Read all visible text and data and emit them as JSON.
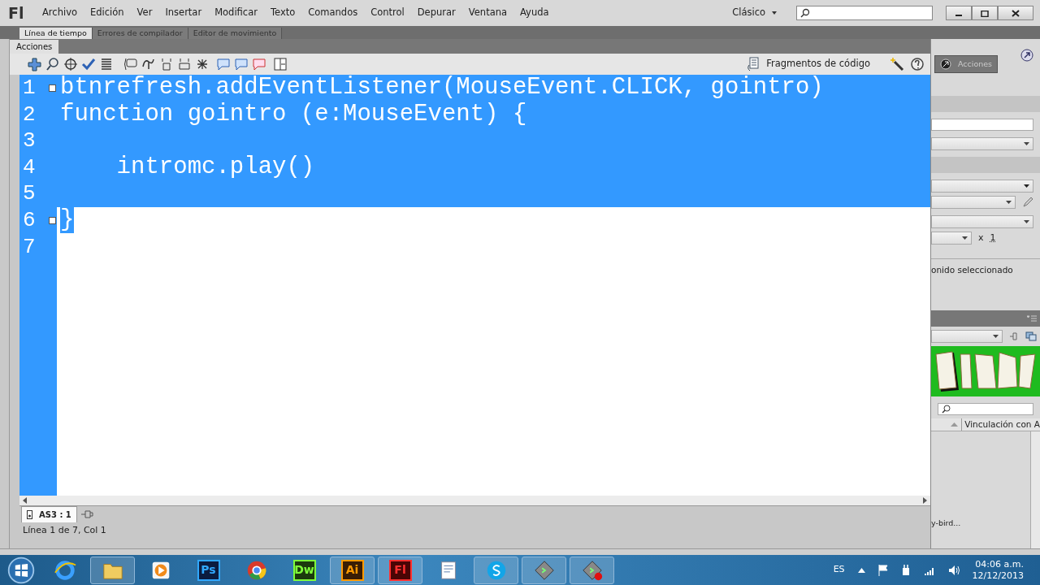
{
  "app_logo": "Fl",
  "menu": [
    "Archivo",
    "Edición",
    "Ver",
    "Insertar",
    "Modificar",
    "Texto",
    "Comandos",
    "Control",
    "Depurar",
    "Ventana",
    "Ayuda"
  ],
  "workspace": "Clásico",
  "panel_tabs": [
    {
      "label": "Línea de tiempo",
      "selected": true
    },
    {
      "label": "Errores de compilador",
      "selected": false
    },
    {
      "label": "Editor de movimiento",
      "selected": false
    }
  ],
  "actions_panel": {
    "title": "Acciones",
    "snippets_label": "Fragmentos de código",
    "lines": [
      {
        "number": "1",
        "text": "btnrefresh.addEventListener(MouseEvent.CLICK, gointro)",
        "selected": true,
        "whole_line": true,
        "fold": true
      },
      {
        "number": "2",
        "text": "function gointro (e:MouseEvent) {",
        "selected": true,
        "whole_line": true,
        "fold": false
      },
      {
        "number": "3",
        "selected": true,
        "whole_line": true,
        "fold": false
      },
      {
        "number": "4",
        "text": "    intromc.play()",
        "selected": true,
        "whole_line": true,
        "fold": false
      },
      {
        "number": "5",
        "selected": true,
        "whole_line": true,
        "fold": false
      },
      {
        "number": "6",
        "text": "}",
        "selected": true,
        "whole_line": false,
        "fold": true
      },
      {
        "number": "7",
        "selected": false,
        "fold": false
      }
    ],
    "script_tab": "AS3 : 1",
    "status": "Línea 1 de 7, Col 1"
  },
  "right_panel": {
    "actions_button": "Acciones",
    "x_label": "x",
    "x_value": "1",
    "sound_label": "onido seleccionado",
    "column_header": "Vinculación con A",
    "library_item": "y-bird..."
  },
  "taskbar": {
    "apps": [
      {
        "kind": "ie",
        "running": false
      },
      {
        "kind": "folder",
        "running": true
      },
      {
        "kind": "media",
        "running": false
      },
      {
        "kind": "ps",
        "label": "Ps",
        "running": false
      },
      {
        "kind": "chrome",
        "running": false
      },
      {
        "kind": "dw",
        "label": "Dw",
        "running": false
      },
      {
        "kind": "ai",
        "label": "Ai",
        "running": true
      },
      {
        "kind": "fl",
        "label": "Fl",
        "running": true
      },
      {
        "kind": "doc",
        "running": false
      },
      {
        "kind": "skype",
        "running": true
      },
      {
        "kind": "tool",
        "running": true
      },
      {
        "kind": "toolrec",
        "running": true
      }
    ],
    "language": "ES",
    "time": "04:06 a.m.",
    "date": "12/12/2013"
  }
}
